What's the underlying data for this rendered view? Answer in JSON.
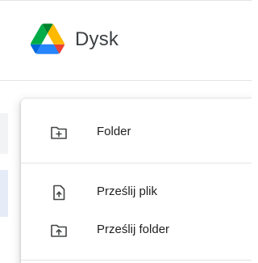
{
  "header": {
    "app_title": "Dysk",
    "logo_icon": "google-drive-logo"
  },
  "menu": {
    "items": [
      {
        "label": "Folder",
        "icon": "new-folder-icon"
      },
      {
        "label": "Prześlij plik",
        "icon": "file-upload-icon"
      },
      {
        "label": "Prześlij folder",
        "icon": "folder-upload-icon"
      }
    ]
  },
  "colors": {
    "text": "#1f1f1f",
    "icon": "#444746",
    "divider": "#e3e3e3",
    "title": "#3c4043"
  }
}
